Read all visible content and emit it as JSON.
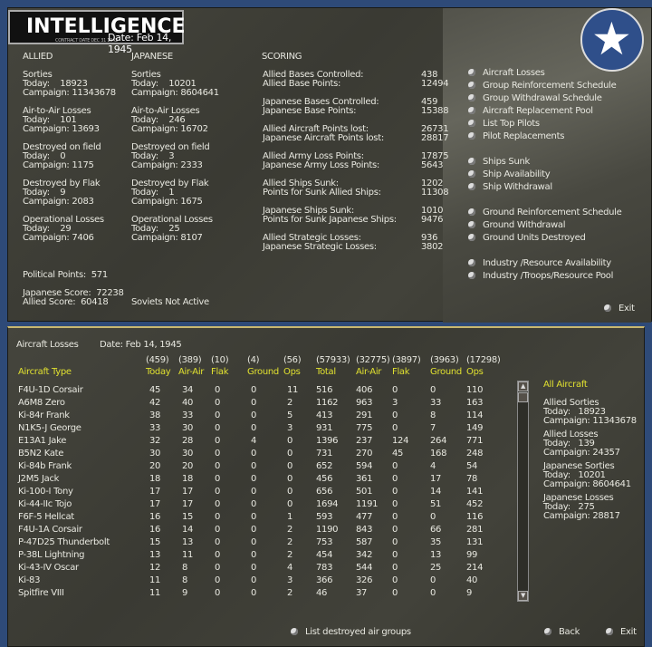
{
  "header": {
    "title": "INTELLIGENCE",
    "subtitle": "CONTRACT DATE DEC 31 1942",
    "date": "Date: Feb 14, 1945"
  },
  "allied": {
    "heading": "ALLIED",
    "blocks": [
      {
        "label": "Sorties",
        "today": "Today:    18923",
        "campaign": "Campaign: 11343678"
      },
      {
        "label": "Air-to-Air Losses",
        "today": "Today:    101",
        "campaign": "Campaign: 13693"
      },
      {
        "label": "Destroyed on field",
        "today": "Today:    0",
        "campaign": "Campaign: 1175"
      },
      {
        "label": "Destroyed by Flak",
        "today": "Today:    9",
        "campaign": "Campaign: 2083"
      },
      {
        "label": "Operational Losses",
        "today": "Today:    29",
        "campaign": "Campaign: 7406"
      }
    ]
  },
  "japanese": {
    "heading": "JAPANESE",
    "blocks": [
      {
        "label": "Sorties",
        "today": "Today:    10201",
        "campaign": "Campaign: 8604641"
      },
      {
        "label": "Air-to-Air Losses",
        "today": "Today:    246",
        "campaign": "Campaign: 16702"
      },
      {
        "label": "Destroyed on field",
        "today": "Today:    3",
        "campaign": "Campaign: 2333"
      },
      {
        "label": "Destroyed by Flak",
        "today": "Today:    1",
        "campaign": "Campaign: 1675"
      },
      {
        "label": "Operational Losses",
        "today": "Today:    25",
        "campaign": "Campaign: 8107"
      }
    ]
  },
  "political_points": "Political Points:  571",
  "japanese_score": "Japanese Score:  72238",
  "allied_score": "Allied Score:  60418",
  "soviets": "Soviets Not Active",
  "scoring": {
    "heading": "SCORING",
    "groups": [
      [
        {
          "label": "Allied Bases Controlled:",
          "value": "438"
        },
        {
          "label": "Allied Base Points:",
          "value": "12494"
        }
      ],
      [
        {
          "label": "Japanese Bases Controlled:",
          "value": "459"
        },
        {
          "label": "Japanese Base Points:",
          "value": "15388"
        }
      ],
      [
        {
          "label": "Allied Aircraft Points lost:",
          "value": "26731"
        },
        {
          "label": "Japanese Aircraft Points lost:",
          "value": "28817"
        }
      ],
      [
        {
          "label": "Allied Army Loss Points:",
          "value": "17875"
        },
        {
          "label": "Japanese Army Loss Points:",
          "value": "5643"
        }
      ],
      [
        {
          "label": "Allied Ships Sunk:",
          "value": "1202"
        },
        {
          "label": "Points for Sunk Allied Ships:",
          "value": "11308"
        }
      ],
      [
        {
          "label": "Japanese Ships Sunk:",
          "value": "1010"
        },
        {
          "label": "Points for Sunk Japanese Ships:",
          "value": "9476"
        }
      ],
      [
        {
          "label": "Allied Strategic Losses:",
          "value": "936"
        },
        {
          "label": "Japanese Strategic Losses:",
          "value": "3802"
        }
      ]
    ]
  },
  "menu": [
    "Aircraft Losses",
    "Group Reinforcement Schedule",
    "Group Withdrawal Schedule",
    "Aircraft Replacement Pool",
    "List Top Pilots",
    "Pilot Replacements",
    "Ships Sunk",
    "Ship Availability",
    "Ship Withdrawal",
    "Ground Reinforcement Schedule",
    "Ground Withdrawal",
    "Ground Units Destroyed",
    "Industry /Resource Availability",
    "Industry /Troops/Resource Pool"
  ],
  "exit": "Exit",
  "losses": {
    "title": "Aircraft Losses",
    "date": "Date: Feb 14, 1945",
    "type_header": "Aircraft Type",
    "headers": [
      "Today",
      "Air-Air",
      "Flak",
      "Ground",
      "Ops",
      "Total",
      "Air-Air",
      "Flak",
      "Ground",
      "Ops"
    ],
    "totals": [
      "(459)",
      "(389)",
      "(10)",
      "(4)",
      "(56)",
      "(57933)",
      "(32775)",
      "(3897)",
      "(3963)",
      "(17298)"
    ],
    "rows": [
      [
        "F4U-1D Corsair",
        "45",
        "34",
        "0",
        "0",
        "11",
        "516",
        "406",
        "0",
        "0",
        "110"
      ],
      [
        "A6M8 Zero",
        "42",
        "40",
        "0",
        "0",
        "2",
        "1162",
        "963",
        "3",
        "33",
        "163"
      ],
      [
        "Ki-84r Frank",
        "38",
        "33",
        "0",
        "0",
        "5",
        "413",
        "291",
        "0",
        "8",
        "114"
      ],
      [
        "N1K5-J George",
        "33",
        "30",
        "0",
        "0",
        "3",
        "931",
        "775",
        "0",
        "7",
        "149"
      ],
      [
        "E13A1 Jake",
        "32",
        "28",
        "0",
        "4",
        "0",
        "1396",
        "237",
        "124",
        "264",
        "771"
      ],
      [
        "B5N2 Kate",
        "30",
        "30",
        "0",
        "0",
        "0",
        "731",
        "270",
        "45",
        "168",
        "248"
      ],
      [
        "Ki-84b Frank",
        "20",
        "20",
        "0",
        "0",
        "0",
        "652",
        "594",
        "0",
        "4",
        "54"
      ],
      [
        "J2M5 Jack",
        "18",
        "18",
        "0",
        "0",
        "0",
        "456",
        "361",
        "0",
        "17",
        "78"
      ],
      [
        "Ki-100-I Tony",
        "17",
        "17",
        "0",
        "0",
        "0",
        "656",
        "501",
        "0",
        "14",
        "141"
      ],
      [
        "Ki-44-IIc Tojo",
        "17",
        "17",
        "0",
        "0",
        "0",
        "1694",
        "1191",
        "0",
        "51",
        "452"
      ],
      [
        "F6F-5 Hellcat",
        "16",
        "15",
        "0",
        "0",
        "1",
        "593",
        "477",
        "0",
        "0",
        "116"
      ],
      [
        "F4U-1A Corsair",
        "16",
        "14",
        "0",
        "0",
        "2",
        "1190",
        "843",
        "0",
        "66",
        "281"
      ],
      [
        "P-47D25 Thunderbolt",
        "15",
        "13",
        "0",
        "0",
        "2",
        "753",
        "587",
        "0",
        "35",
        "131"
      ],
      [
        "P-38L Lightning",
        "13",
        "11",
        "0",
        "0",
        "2",
        "454",
        "342",
        "0",
        "13",
        "99"
      ],
      [
        "Ki-43-IV Oscar",
        "12",
        "8",
        "0",
        "0",
        "4",
        "783",
        "544",
        "0",
        "25",
        "214"
      ],
      [
        "Ki-83",
        "11",
        "8",
        "0",
        "0",
        "3",
        "366",
        "326",
        "0",
        "0",
        "40"
      ],
      [
        "Spitfire VIII",
        "11",
        "9",
        "0",
        "0",
        "2",
        "46",
        "37",
        "0",
        "0",
        "9"
      ]
    ]
  },
  "summary": {
    "filter": "All Aircraft",
    "blocks": [
      {
        "label": "Allied Sorties",
        "today": "Today:   18923",
        "campaign": "Campaign: 11343678"
      },
      {
        "label": "Allied Losses",
        "today": "Today:   139",
        "campaign": "Campaign: 24357"
      },
      {
        "label": "Japanese Sorties",
        "today": "Today:   10201",
        "campaign": "Campaign: 8604641"
      },
      {
        "label": "Japanese Losses",
        "today": "Today:   275",
        "campaign": "Campaign: 28817"
      }
    ]
  },
  "bottom": {
    "list_destroyed": "List destroyed air groups",
    "back": "Back",
    "exit": "Exit"
  }
}
